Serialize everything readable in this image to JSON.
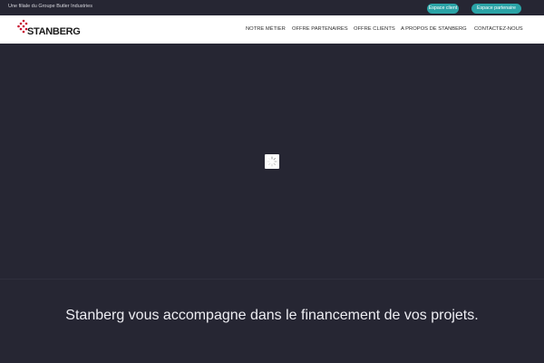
{
  "topbar": {
    "subsidiary_text": "Une filiale du Groupe Butler Industries",
    "client_button": "Espace client",
    "partner_button": "Espace partenaire"
  },
  "header": {
    "logo_text": "STANBERG",
    "nav": [
      "NOTRE MÉTIER",
      "OFFRE PARTENAIRES",
      "OFFRE CLIENTS",
      "A PROPOS DE STANBERG",
      "CONTACTEZ-NOUS"
    ]
  },
  "hero": {
    "tagline": "Stanberg vous accompagne dans le financement de vos projets."
  },
  "colors": {
    "dark_background": "#262633",
    "accent_teal": "#2aa3a6",
    "logo_red": "#c8102e"
  }
}
